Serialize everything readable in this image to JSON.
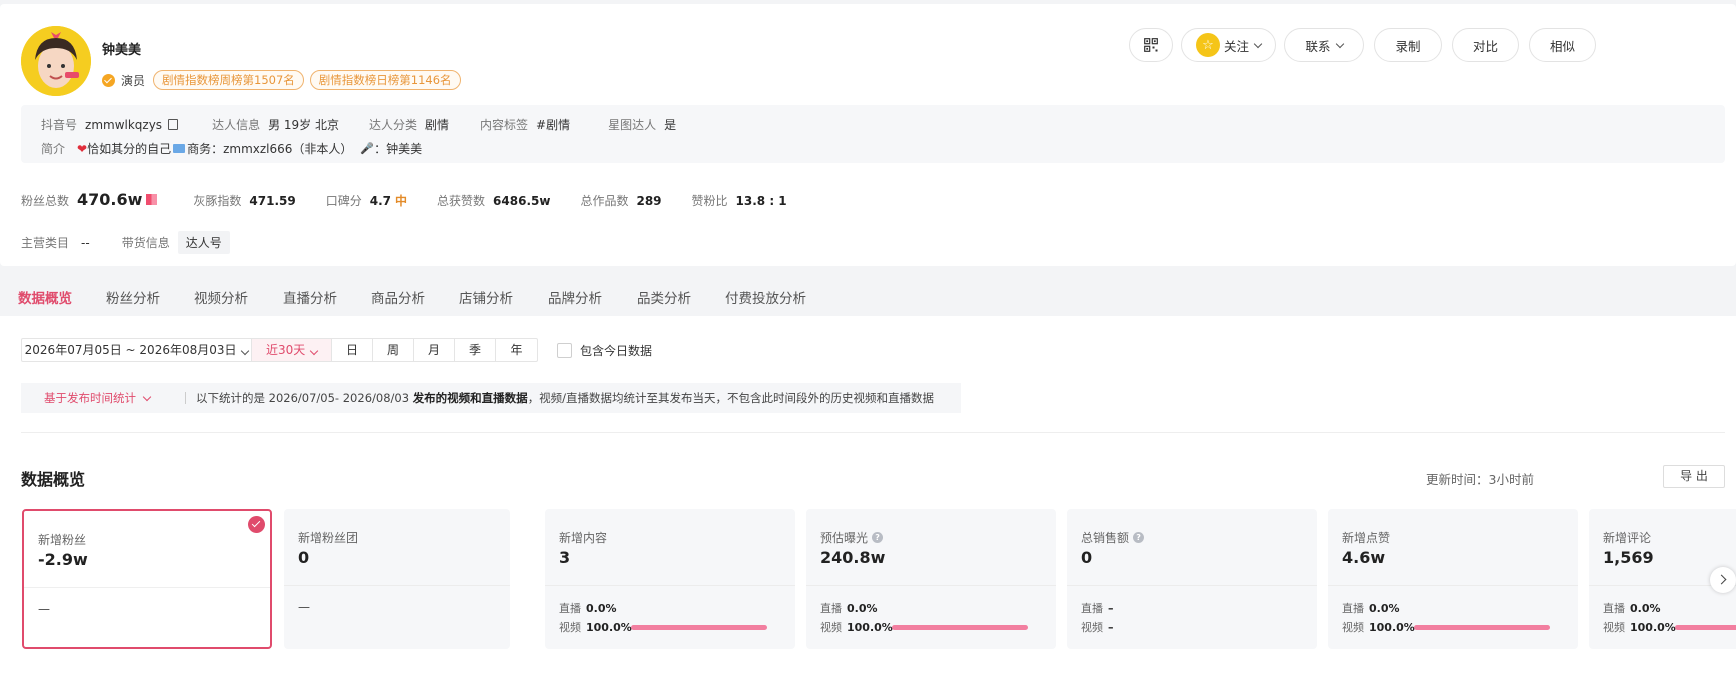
{
  "profile": {
    "name": "钟美美",
    "role": "演员",
    "rank_weekly": "剧情指数榜周榜第1507名",
    "rank_daily": "剧情指数榜日榜第1146名"
  },
  "actions": {
    "follow": "关注",
    "contact": "联系",
    "record": "录制",
    "compare": "对比",
    "similar": "相似"
  },
  "info": {
    "douyin_label": "抖音号",
    "douyin_value": "zmmwlkqzys",
    "person_label": "达人信息",
    "person_value": "男 19岁 北京",
    "category_label": "达人分类",
    "category_value": "剧情",
    "content_label": "内容标签",
    "content_value": "#剧情",
    "star_label": "星图达人",
    "star_value": "是",
    "intro_label": "简介",
    "intro_text1": "恰如其分的自己",
    "intro_text2": "商务：zmmxzl666（非本人）",
    "intro_text3": "：钟美美"
  },
  "stats": {
    "fans_label": "粉丝总数",
    "fans_value": "470.6w",
    "grey_label": "灰豚指数",
    "grey_value": "471.59",
    "rep_label": "口碑分",
    "rep_value": "4.7",
    "rep_level": "中",
    "likes_label": "总获赞数",
    "likes_value": "6486.5w",
    "works_label": "总作品数",
    "works_value": "289",
    "ratio_label": "赞粉比",
    "ratio_value": "13.8 : 1"
  },
  "row3": {
    "main_label": "主营类目",
    "main_value": "--",
    "goods_label": "带货信息",
    "goods_value": "达人号"
  },
  "tabs": [
    "数据概览",
    "粉丝分析",
    "视频分析",
    "直播分析",
    "商品分析",
    "店铺分析",
    "品牌分析",
    "品类分析",
    "付费投放分析"
  ],
  "filters": {
    "date_range": "2026年07月05日 ~ 2026年08月03日",
    "recent": "近30天",
    "units": [
      "日",
      "周",
      "月",
      "季",
      "年"
    ],
    "include_today": "包含今日数据",
    "basis": "基于发布时间统计",
    "notice_prefix": "以下统计的是 2026/07/05- 2026/08/03 ",
    "notice_bold": "发布的视频和直播数据",
    "notice_suffix": "，视频/直播数据均统计至其发布当天，不包含此时间段外的历史视频和直播数据"
  },
  "overview": {
    "title": "数据概览",
    "update_time": "更新时间：3小时前",
    "export": "导 出"
  },
  "cards": [
    {
      "title": "新增粉丝",
      "value": "-2.9w",
      "bottom": "—"
    },
    {
      "title": "新增粉丝团",
      "value": "0",
      "bottom": "—"
    },
    {
      "title": "新增内容",
      "value": "3",
      "live_label": "直播",
      "live": "0.0%",
      "video_label": "视频",
      "video": "100.0%"
    },
    {
      "title": "预估曝光",
      "value": "240.8w",
      "live_label": "直播",
      "live": "0.0%",
      "video_label": "视频",
      "video": "100.0%"
    },
    {
      "title": "总销售额",
      "value": "0",
      "live_label": "直播",
      "live": "–",
      "video_label": "视频",
      "video": "–"
    },
    {
      "title": "新增点赞",
      "value": "4.6w",
      "live_label": "直播",
      "live": "0.0%",
      "video_label": "视频",
      "video": "100.0%"
    },
    {
      "title": "新增评论",
      "value": "1,569",
      "live_label": "直播",
      "live": "0.0%",
      "video_label": "视频",
      "video": "100.0%"
    }
  ],
  "colors": {
    "accent": "#e04b6c",
    "rank": "#e8963a",
    "bar": "#f27fa0"
  }
}
